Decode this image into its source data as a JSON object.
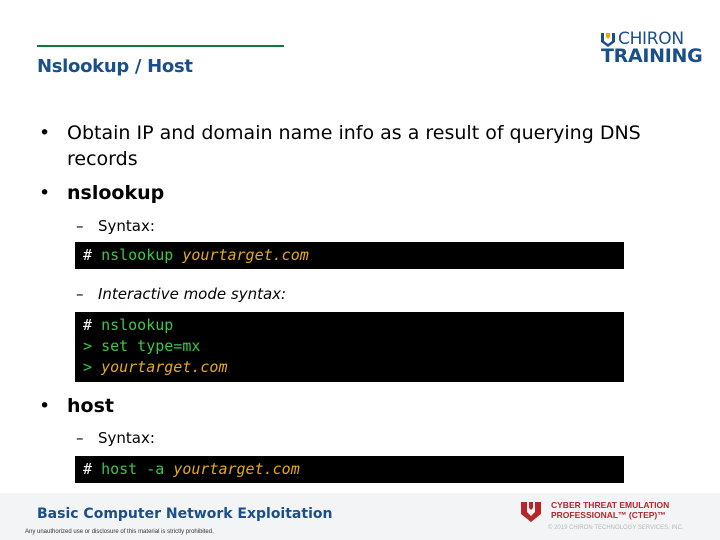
{
  "header": {
    "title": "Nslookup / Host"
  },
  "logo": {
    "line1": "CHIRON",
    "line2": "TRAINING"
  },
  "content": {
    "bullet1": "Obtain IP and domain name info as a result of querying DNS records",
    "bullet2": "nslookup",
    "sub1": "Syntax:",
    "code1": {
      "prompt": "#",
      "cmd": "nslookup",
      "arg": "yourtarget.com"
    },
    "sub2": "Interactive mode syntax:",
    "code2": {
      "line1_prompt": "#",
      "line1_cmd": "nslookup",
      "line2_prompt": ">",
      "line2_cmd": "set type=mx",
      "line3_prompt": ">",
      "line3_arg": "yourtarget.com"
    },
    "bullet3": "host",
    "sub3": "Syntax:",
    "code3": {
      "prompt": "#",
      "cmd": "host -a",
      "arg": "yourtarget.com"
    }
  },
  "footer": {
    "title": "Basic Computer Network Exploitation",
    "notice": "Any unauthorized use or disclosure of this material is strictly prohibited.",
    "ctep_line1": "CYBER THREAT EMULATION",
    "ctep_line2": "PROFESSIONAL™ (CTEP)™",
    "copyright": "© 2019 CHIRON TECHNOLOGY SERVICES, INC."
  },
  "colors": {
    "title": "#1a4f8a",
    "rule": "#0e7a3c",
    "code_bg": "#000000",
    "cmd": "#3bc64b",
    "arg": "#e6a817",
    "ctep": "#b5262b"
  }
}
